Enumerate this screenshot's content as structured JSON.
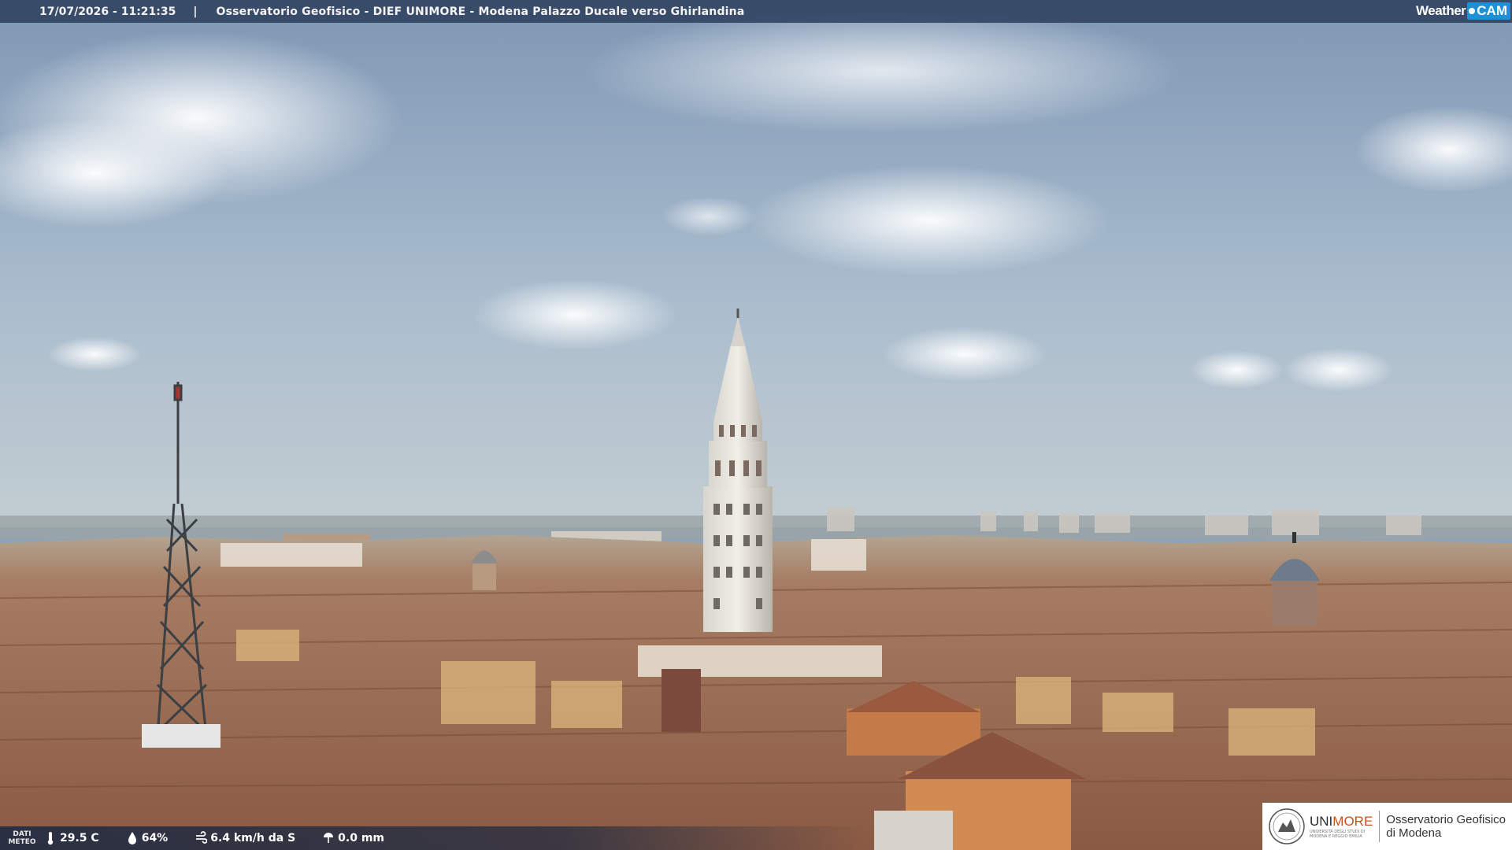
{
  "caption": {
    "timestamp": "17/07/2026 - 11:21:35",
    "separator": "|",
    "title": "Osservatorio Geofisico - DIEF UNIMORE - Modena Palazzo Ducale verso Ghirlandina"
  },
  "brand": {
    "weather": "Weather",
    "cam": "CAM"
  },
  "weather_bar": {
    "label_line1": "DATI",
    "label_line2": "METEO",
    "temperature": "29.5 C",
    "humidity": "64%",
    "wind": "6.4 km/h da S",
    "rain": "0.0 mm",
    "icons": [
      "thermometer-icon",
      "humidity-drop-icon",
      "wind-icon",
      "rain-gauge-icon"
    ]
  },
  "logo": {
    "university_prefix": "UNI",
    "university_suffix": "MORE",
    "university_sub1": "UNIVERSITÀ DEGLI STUDI DI",
    "university_sub2": "MODENA E REGGIO EMILIA",
    "observatory_line1": "Osservatorio Geofisico",
    "observatory_line2": "di Modena"
  },
  "colors": {
    "caption_bar": "#283a58",
    "brand_blue": "#1f8fd6",
    "unimore_accent": "#c6541e",
    "roof_terracotta": "#a8694a",
    "sky": "#9fb3c7"
  }
}
